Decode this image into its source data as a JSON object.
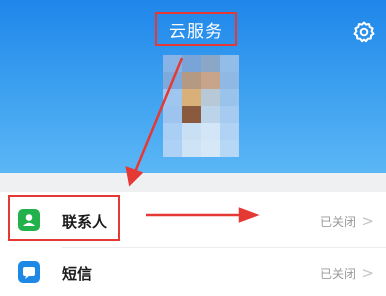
{
  "header": {
    "title": "云服务",
    "background_color": "#2b8fec",
    "highlight_color": "#e53935"
  },
  "icons": {
    "settings": "gear-icon",
    "contacts": "contacts-icon",
    "sms": "message-icon"
  },
  "list": {
    "items": [
      {
        "label": "联系人",
        "status": "已关闭",
        "icon_color": "#22b14c"
      },
      {
        "label": "短信",
        "status": "已关闭",
        "icon_color": "#1e88e5"
      }
    ]
  }
}
